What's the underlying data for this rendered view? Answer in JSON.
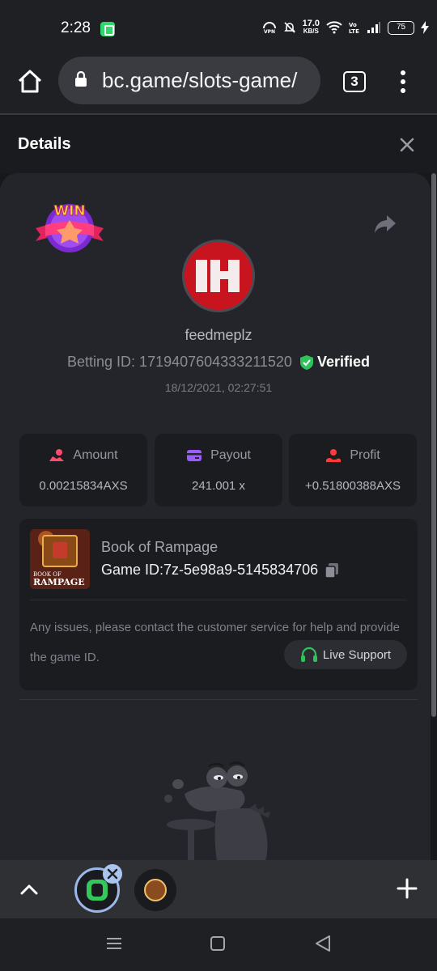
{
  "status_bar": {
    "time": "2:28",
    "net_speed": "17.0",
    "net_unit": "KB/S",
    "battery": "75"
  },
  "browser": {
    "url": "bc.game/slots-game/",
    "tab_count": "3"
  },
  "details": {
    "title": "Details",
    "win_badge_text": "WIN",
    "username": "feedmeplz",
    "betting_id": "Betting ID: 1719407604333211520",
    "verified_label": "Verified",
    "date": "18/12/2021, 02:27:51"
  },
  "stats": [
    {
      "label": "Amount",
      "value": "0.00215834AXS",
      "icon": "amount-icon",
      "color": "#ff4c6e"
    },
    {
      "label": "Payout",
      "value": "241.001 x",
      "icon": "payout-card-icon",
      "color": "#9b5cff"
    },
    {
      "label": "Profit",
      "value": "+0.51800388AXS",
      "icon": "profit-icon",
      "color": "#ff3a3a"
    }
  ],
  "game": {
    "name": "Book of Rampage",
    "id_text": "Game ID:7z-5e98a9-5145834706",
    "thumb_text_top": "BOOK OF",
    "thumb_text_bottom": "RAMPAGE"
  },
  "support": {
    "issue_text": "Any issues, please contact the customer service for help and provide the game ID.",
    "live_support_label": "Live Support"
  },
  "colors": {
    "accent_green": "#2fc25b",
    "panel_bg": "#24252a",
    "card_bg": "#1b1c20"
  }
}
